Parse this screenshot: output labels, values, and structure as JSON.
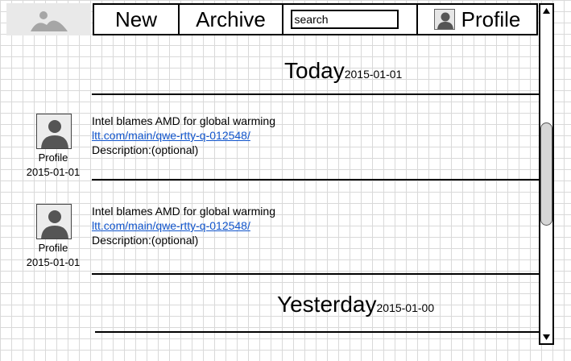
{
  "nav": {
    "new_label": "New",
    "archive_label": "Archive",
    "search_placeholder": "search",
    "profile_label": "Profile"
  },
  "sections": [
    {
      "heading": "Today",
      "date": "2015-01-01"
    },
    {
      "heading": "Yesterday",
      "date": "2015-01-00"
    }
  ],
  "posts": [
    {
      "title": "Intel blames AMD for global warming",
      "link": "ltt.com/main/qwe-rtty-q-012548/",
      "description": "Description:(optional)",
      "author_label": "Profile",
      "date": "2015-01-01"
    },
    {
      "title": "Intel blames AMD for global warming",
      "link": "ltt.com/main/qwe-rtty-q-012548/",
      "description": "Description:(optional)",
      "author_label": "Profile",
      "date": "2015-01-01"
    }
  ],
  "icons": {
    "logo": "image-placeholder-icon",
    "avatar": "user-avatar-icon",
    "scroll_up": "triangle-up-icon",
    "scroll_down": "triangle-down-icon"
  },
  "colors": {
    "link": "#1155cc",
    "placeholder_bg": "#e9e9e9",
    "grid": "#d9d9d9"
  }
}
